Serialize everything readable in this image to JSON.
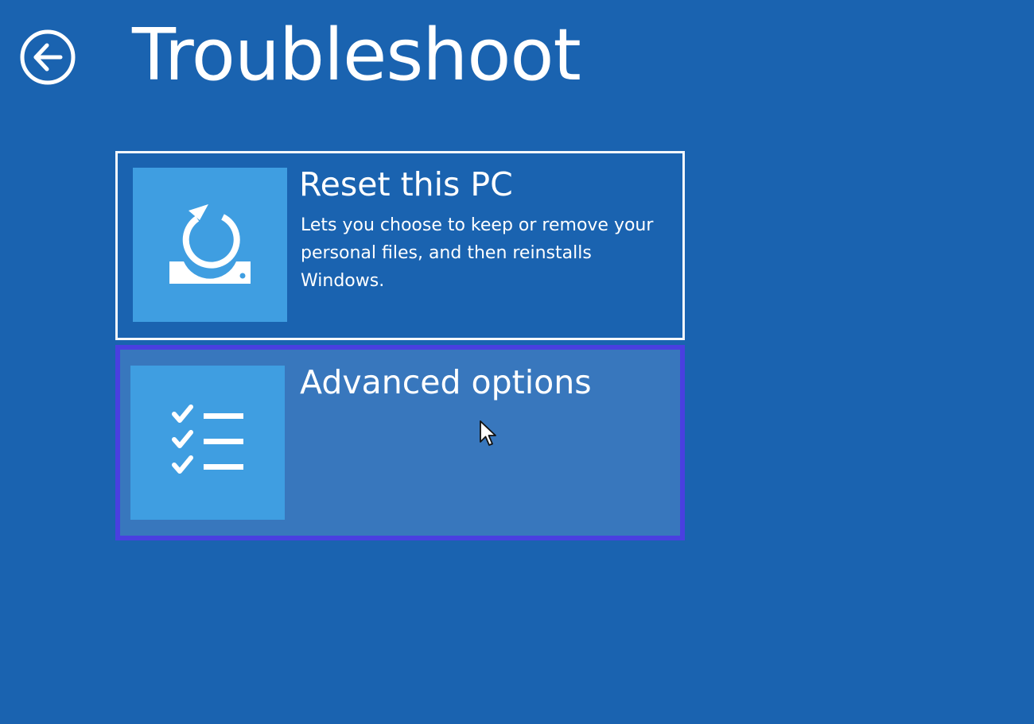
{
  "header": {
    "title": "Troubleshoot",
    "back_icon": "back-arrow-icon"
  },
  "options": [
    {
      "title": "Reset this PC",
      "description": "Lets you choose to keep or remove your personal files, and then reinstalls Windows.",
      "icon": "reset-pc-icon",
      "state": "focused"
    },
    {
      "title": "Advanced options",
      "description": "",
      "icon": "checklist-icon",
      "state": "hovered"
    }
  ],
  "colors": {
    "background": "#1a63b0",
    "icon_tile": "#3f9ee1",
    "hover_fill": "#3877bd",
    "hover_border": "#4a3fe0",
    "focus_border": "#f4f7fb"
  }
}
